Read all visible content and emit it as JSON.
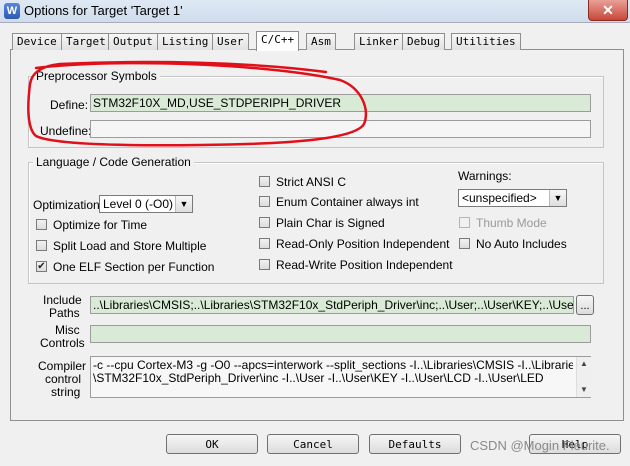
{
  "window": {
    "title": "Options for Target 'Target 1'",
    "app_icon": "W",
    "close_glyph": "✕"
  },
  "tabs": [
    {
      "label": "Device"
    },
    {
      "label": "Target"
    },
    {
      "label": "Output"
    },
    {
      "label": "Listing"
    },
    {
      "label": "User"
    },
    {
      "label": "C/C++"
    },
    {
      "label": "Asm"
    },
    {
      "label": "Linker"
    },
    {
      "label": "Debug"
    },
    {
      "label": "Utilities"
    }
  ],
  "active_tab": "C/C++",
  "preprocessor": {
    "title": "Preprocessor Symbols",
    "define_label": "Define:",
    "define_value": "STM32F10X_MD,USE_STDPERIPH_DRIVER",
    "undefine_label": "Undefine:",
    "undefine_value": ""
  },
  "codegen": {
    "title": "Language / Code Generation",
    "optimization_label": "Optimization:",
    "optimization_value": "Level 0 (-O0)",
    "options": [
      {
        "label": "Optimize for Time",
        "checked": false
      },
      {
        "label": "Split Load and Store Multiple",
        "checked": false
      },
      {
        "label": "One ELF Section per Function",
        "checked": true
      },
      {
        "label": "Strict ANSI C",
        "checked": false
      },
      {
        "label": "Enum Container always int",
        "checked": false
      },
      {
        "label": "Plain Char is Signed",
        "checked": false
      },
      {
        "label": "Read-Only Position Independent",
        "checked": false
      },
      {
        "label": "Read-Write Position Independent",
        "checked": false
      },
      {
        "label": "Thumb Mode",
        "checked": false,
        "disabled": true
      },
      {
        "label": "No Auto Includes",
        "checked": false
      }
    ],
    "warnings_label": "Warnings:",
    "warnings_value": "<unspecified>"
  },
  "include_paths": {
    "label_line1": "Include",
    "label_line2": "Paths",
    "value": "..\\Libraries\\CMSIS;..\\Libraries\\STM32F10x_StdPeriph_Driver\\inc;..\\User;..\\User\\KEY;..\\User\\LCD;..\\User",
    "browse_label": "..."
  },
  "misc_controls": {
    "label_line1": "Misc",
    "label_line2": "Controls",
    "value": ""
  },
  "compiler_control": {
    "label_line1": "Compiler",
    "label_line2": "control",
    "label_line3": "string",
    "line1": "-c --cpu Cortex-M3 -g -O0 --apcs=interwork --split_sections -I..\\Libraries\\CMSIS -I..\\Libraries",
    "line2": "\\STM32F10x_StdPeriph_Driver\\inc -I..\\User -I..\\User\\KEY -I..\\User\\LCD -I..\\User\\LED"
  },
  "buttons": {
    "ok": "OK",
    "cancel": "Cancel",
    "defaults": "Defaults",
    "help": "Help"
  },
  "watermark": "CSDN @Mogin Fleurite.",
  "annotation_color": "#e0101a"
}
